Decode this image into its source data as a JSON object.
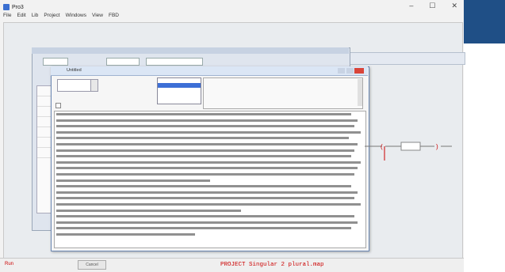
{
  "app": {
    "title": "Pro3",
    "menu": [
      "File",
      "Edit",
      "Lib",
      "Project",
      "Windows",
      "View",
      "FBD"
    ],
    "window_controls": [
      "–",
      "☐",
      "✕"
    ]
  },
  "background_window": {
    "wide_title": "",
    "toolbar_values": [
      ""
    ]
  },
  "dialog": {
    "title": "Untitled",
    "editor_value": "",
    "list_items": [
      {
        "label": "",
        "selected": false
      },
      {
        "label": "",
        "selected": true
      },
      {
        "label": "",
        "selected": false
      },
      {
        "label": "",
        "selected": false
      }
    ],
    "info_lines": [
      "",
      "",
      "",
      "",
      ""
    ],
    "checkbox_label": ""
  },
  "status": {
    "left": "Run",
    "cancel": "Cancel",
    "project": "PROJECT  Singular 2 plural.map",
    "right": ""
  },
  "colors": {
    "accent": "#3d6fd6",
    "status_red": "#cc0000",
    "right_panel": "#1f4f86"
  }
}
